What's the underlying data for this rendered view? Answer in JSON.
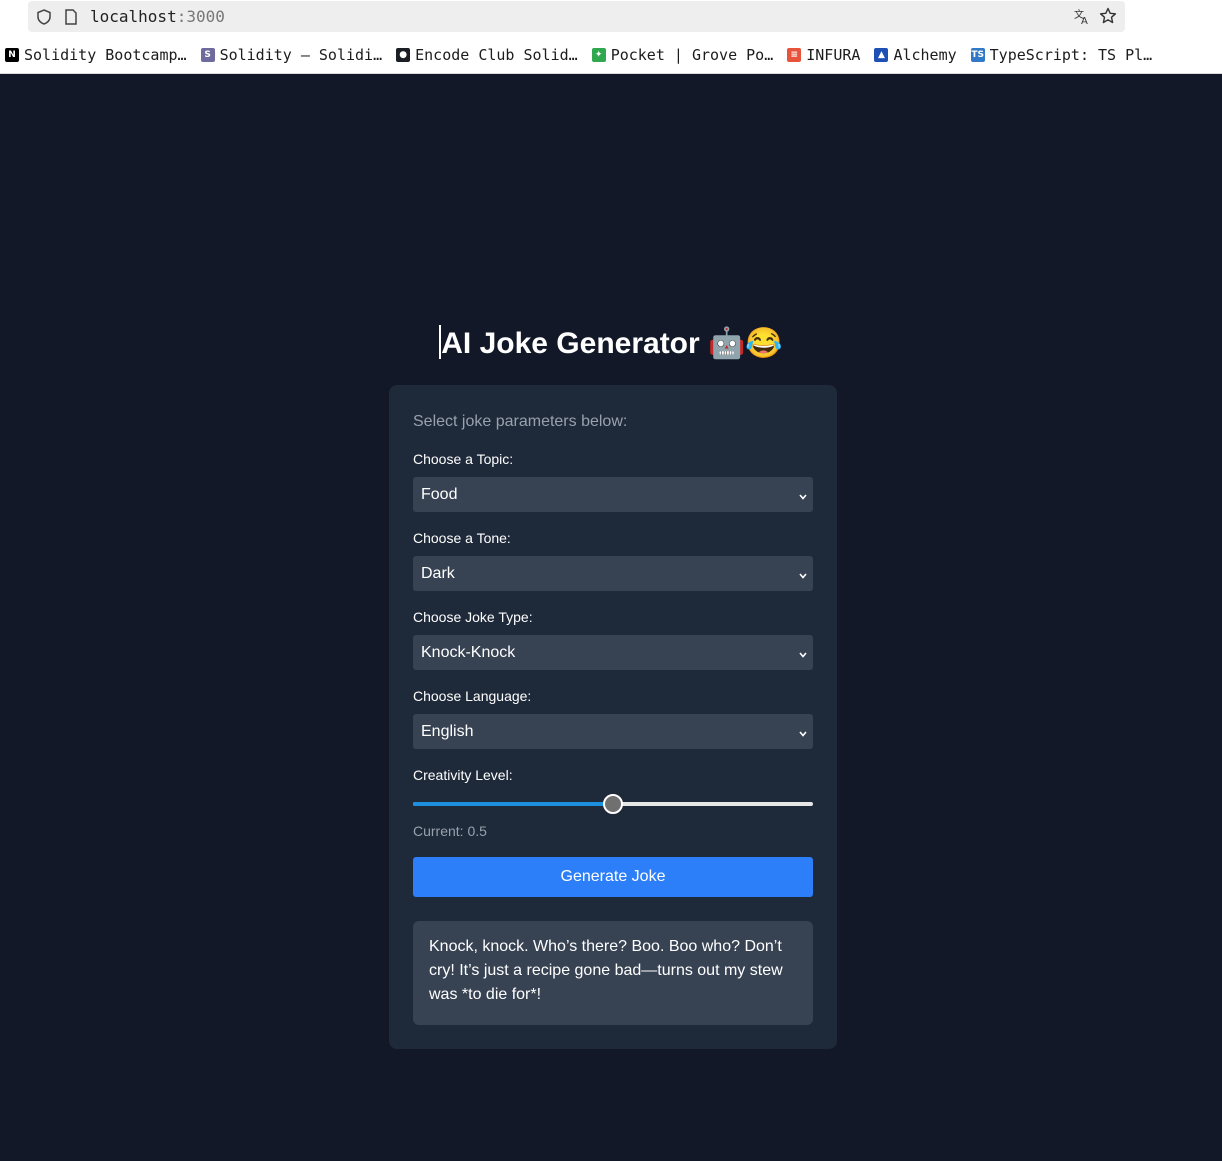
{
  "browser": {
    "url_host": "localhost",
    "url_port": ":3000",
    "bookmarks": [
      {
        "label": "Solidity Bootcamp…",
        "icon": "notion-icon",
        "color": "#000000",
        "glyph": "N"
      },
      {
        "label": "Solidity — Solidi…",
        "icon": "solidity-icon",
        "color": "#6e6a9e",
        "glyph": "S"
      },
      {
        "label": "Encode Club Solid…",
        "icon": "github-icon",
        "color": "#1b1f23",
        "glyph": "●"
      },
      {
        "label": "Pocket | Grove Po…",
        "icon": "pocket-icon",
        "color": "#2fa84f",
        "glyph": "✦"
      },
      {
        "label": "INFURA",
        "icon": "infura-icon",
        "color": "#e8543b",
        "glyph": "≡"
      },
      {
        "label": "Alchemy",
        "icon": "alchemy-icon",
        "color": "#1e4fb5",
        "glyph": "▲"
      },
      {
        "label": "TypeScript: TS Pl…",
        "icon": "typescript-icon",
        "color": "#3178c6",
        "glyph": "TS"
      }
    ]
  },
  "app": {
    "title": "AI Joke Generator 🤖😂",
    "subtitle": "Select joke parameters below:",
    "fields": [
      {
        "label": "Choose a Topic:",
        "value": "Food"
      },
      {
        "label": "Choose a Tone:",
        "value": "Dark"
      },
      {
        "label": "Choose Joke Type:",
        "value": "Knock-Knock"
      },
      {
        "label": "Choose Language:",
        "value": "English"
      }
    ],
    "creativity": {
      "label": "Creativity Level:",
      "value": 0.5,
      "current_text": "Current: 0.5"
    },
    "generate_label": "Generate Joke",
    "joke": "Knock, knock. Who’s there? Boo. Boo who? Don’t cry! It’s just a recipe gone bad—turns out my stew was *to die for*!"
  },
  "colors": {
    "background": "#121827",
    "card": "#1e2939",
    "input": "#374253",
    "accent": "#2d7ff9",
    "slider_fill": "#1d8fdf"
  }
}
